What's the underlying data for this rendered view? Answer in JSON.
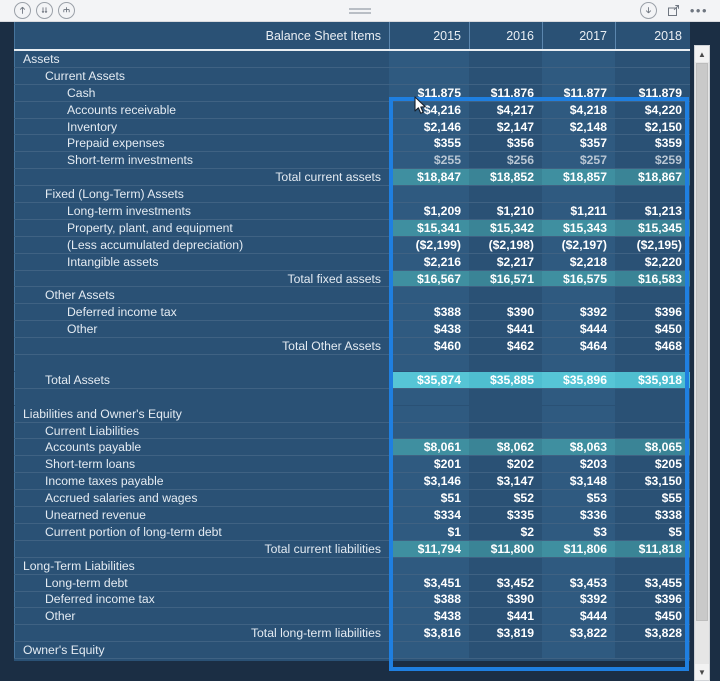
{
  "toolbar": {
    "left_icons": [
      {
        "name": "drill-up-icon",
        "glyph": "↑"
      },
      {
        "name": "expand-all-down-icon",
        "glyph": "↓↓"
      },
      {
        "name": "drill-down-hierarchy-icon",
        "glyph": "⌂"
      }
    ],
    "drag_handle": "drag-handle",
    "right_icons": [
      {
        "name": "download-icon",
        "glyph": "↓"
      },
      {
        "name": "focus-mode-icon",
        "glyph": "⤢"
      },
      {
        "name": "more-options-icon",
        "glyph": "···"
      }
    ]
  },
  "matrix": {
    "row_header_label": "Balance Sheet Items",
    "columns": [
      "2015",
      "2016",
      "2017",
      "2018"
    ],
    "rows": [
      {
        "label": "Assets",
        "level": 0,
        "values": [
          "",
          "",
          "",
          ""
        ],
        "style": "normal"
      },
      {
        "label": "Current Assets",
        "level": 1,
        "values": [
          "",
          "",
          "",
          ""
        ],
        "style": "normal"
      },
      {
        "label": "Cash",
        "level": 2,
        "values": [
          "$11,875",
          "$11,876",
          "$11,877",
          "$11,879"
        ],
        "style": "normal"
      },
      {
        "label": "Accounts receivable",
        "level": 2,
        "values": [
          "$4,216",
          "$4,217",
          "$4,218",
          "$4,220"
        ],
        "style": "normal"
      },
      {
        "label": "Inventory",
        "level": 2,
        "values": [
          "$2,146",
          "$2,147",
          "$2,148",
          "$2,150"
        ],
        "style": "normal"
      },
      {
        "label": "Prepaid expenses",
        "level": 2,
        "values": [
          "$355",
          "$356",
          "$357",
          "$359"
        ],
        "style": "normal"
      },
      {
        "label": "Short-term investments",
        "level": 2,
        "values": [
          "$255",
          "$256",
          "$257",
          "$259"
        ],
        "style": "dim"
      },
      {
        "label": "Total current assets",
        "level": 9,
        "values": [
          "$18,847",
          "$18,852",
          "$18,857",
          "$18,867"
        ],
        "style": "total"
      },
      {
        "label": "Fixed (Long-Term) Assets",
        "level": 1,
        "values": [
          "",
          "",
          "",
          ""
        ],
        "style": "normal"
      },
      {
        "label": "Long-term investments",
        "level": 2,
        "values": [
          "$1,209",
          "$1,210",
          "$1,211",
          "$1,213"
        ],
        "style": "normal"
      },
      {
        "label": "Property, plant, and equipment",
        "level": 2,
        "values": [
          "$15,341",
          "$15,342",
          "$15,343",
          "$15,345"
        ],
        "style": "total"
      },
      {
        "label": "(Less accumulated depreciation)",
        "level": 2,
        "values": [
          "($2,199)",
          "($2,198)",
          "($2,197)",
          "($2,195)"
        ],
        "style": "normal"
      },
      {
        "label": "Intangible assets",
        "level": 2,
        "values": [
          "$2,216",
          "$2,217",
          "$2,218",
          "$2,220"
        ],
        "style": "normal"
      },
      {
        "label": "Total fixed assets",
        "level": 9,
        "values": [
          "$16,567",
          "$16,571",
          "$16,575",
          "$16,583"
        ],
        "style": "total"
      },
      {
        "label": "Other Assets",
        "level": 1,
        "values": [
          "",
          "",
          "",
          ""
        ],
        "style": "normal"
      },
      {
        "label": "Deferred income tax",
        "level": 2,
        "values": [
          "$388",
          "$390",
          "$392",
          "$396"
        ],
        "style": "normal"
      },
      {
        "label": "Other",
        "level": 2,
        "values": [
          "$438",
          "$441",
          "$444",
          "$450"
        ],
        "style": "normal"
      },
      {
        "label": "Total Other Assets",
        "level": 9,
        "values": [
          "$460",
          "$462",
          "$464",
          "$468"
        ],
        "style": "normal"
      },
      {
        "label": "",
        "level": 0,
        "values": [
          "",
          "",
          "",
          ""
        ],
        "style": "normal"
      },
      {
        "label": "Total Assets",
        "level": 1,
        "values": [
          "$35,874",
          "$35,885",
          "$35,896",
          "$35,918"
        ],
        "style": "grandtotal"
      },
      {
        "label": "",
        "level": 0,
        "values": [
          "",
          "",
          "",
          ""
        ],
        "style": "normal"
      },
      {
        "label": "Liabilities and Owner's Equity",
        "level": 0,
        "values": [
          "",
          "",
          "",
          ""
        ],
        "style": "normal"
      },
      {
        "label": "Current Liabilities",
        "level": 1,
        "values": [
          "",
          "",
          "",
          ""
        ],
        "style": "normal"
      },
      {
        "label": "Accounts payable",
        "level": 1,
        "values": [
          "$8,061",
          "$8,062",
          "$8,063",
          "$8,065"
        ],
        "style": "total"
      },
      {
        "label": "Short-term loans",
        "level": 1,
        "values": [
          "$201",
          "$202",
          "$203",
          "$205"
        ],
        "style": "normal"
      },
      {
        "label": "Income taxes payable",
        "level": 1,
        "values": [
          "$3,146",
          "$3,147",
          "$3,148",
          "$3,150"
        ],
        "style": "normal"
      },
      {
        "label": "Accrued salaries and wages",
        "level": 1,
        "values": [
          "$51",
          "$52",
          "$53",
          "$55"
        ],
        "style": "normal"
      },
      {
        "label": "Unearned revenue",
        "level": 1,
        "values": [
          "$334",
          "$335",
          "$336",
          "$338"
        ],
        "style": "normal"
      },
      {
        "label": "Current portion of long-term debt",
        "level": 1,
        "values": [
          "$1",
          "$2",
          "$3",
          "$5"
        ],
        "style": "normal"
      },
      {
        "label": "Total current liabilities",
        "level": 9,
        "values": [
          "$11,794",
          "$11,800",
          "$11,806",
          "$11,818"
        ],
        "style": "total"
      },
      {
        "label": "Long-Term Liabilities",
        "level": 0,
        "values": [
          "",
          "",
          "",
          ""
        ],
        "style": "normal"
      },
      {
        "label": "Long-term debt",
        "level": 1,
        "values": [
          "$3,451",
          "$3,452",
          "$3,453",
          "$3,455"
        ],
        "style": "normal"
      },
      {
        "label": "Deferred income tax",
        "level": 1,
        "values": [
          "$388",
          "$390",
          "$392",
          "$396"
        ],
        "style": "normal"
      },
      {
        "label": "Other",
        "level": 1,
        "values": [
          "$438",
          "$441",
          "$444",
          "$450"
        ],
        "style": "normal"
      },
      {
        "label": "Total long-term liabilities",
        "level": 9,
        "values": [
          "$3,816",
          "$3,819",
          "$3,822",
          "$3,828"
        ],
        "style": "normal"
      },
      {
        "label": "Owner's Equity",
        "level": 0,
        "values": [
          "",
          "",
          "",
          ""
        ],
        "style": "normal"
      }
    ]
  },
  "colors": {
    "background": "#1b2e44",
    "grid": "#2a5175",
    "grid_alt": "#2f5a80",
    "total_teal": "#3f8fa0",
    "grand_total_teal": "#56c5d6",
    "selection_blue": "#1f7fe0",
    "toolbar_bg": "#f3f4f6"
  }
}
